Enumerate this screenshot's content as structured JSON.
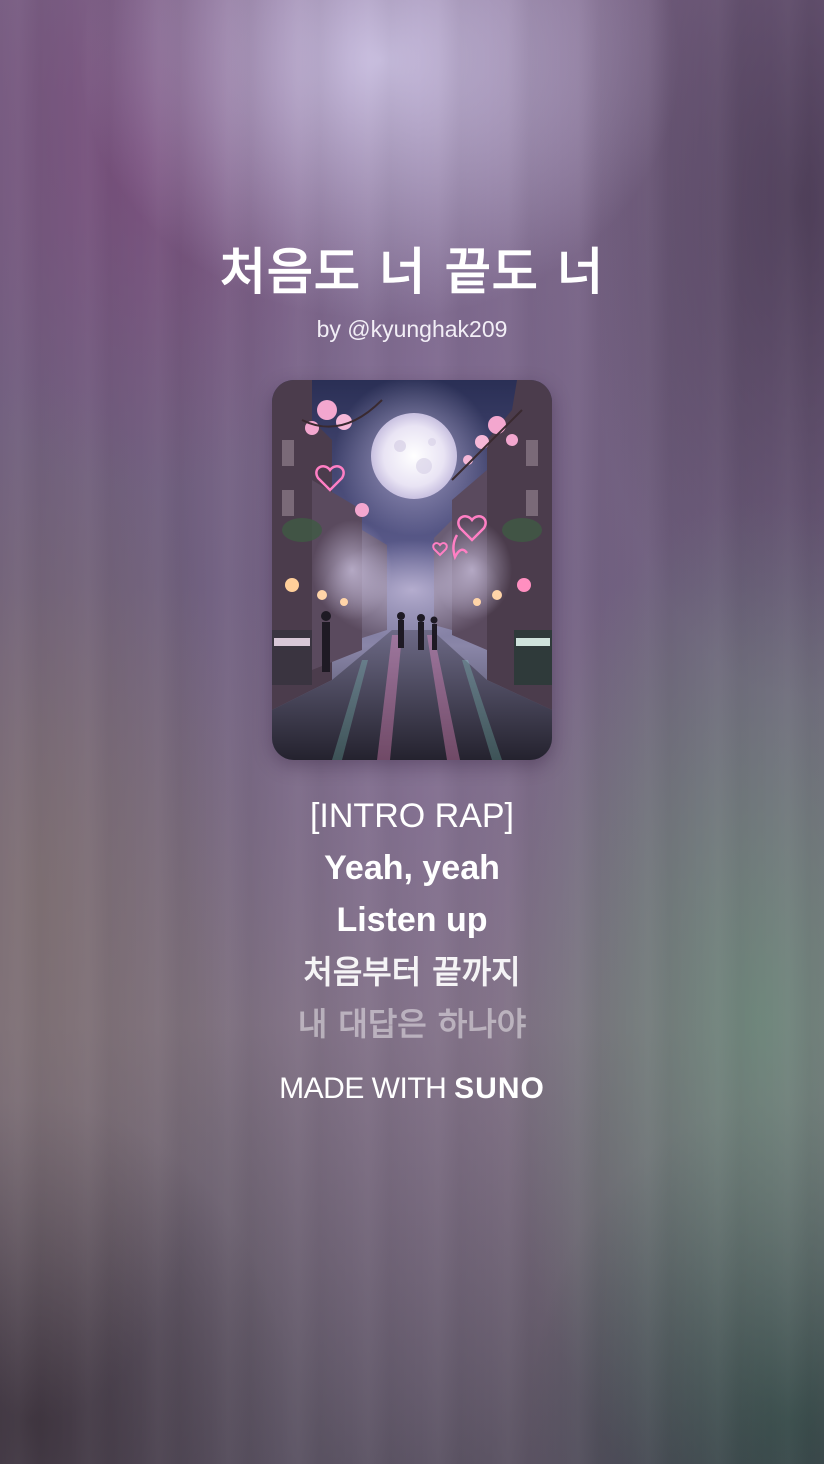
{
  "song": {
    "title": "처음도 너 끝도 너",
    "byline": "by @kyunghak209"
  },
  "lyrics": [
    "[INTRO RAP]",
    "Yeah, yeah",
    "Listen up",
    "처음부터 끝까지",
    "내 대답은 하나야"
  ],
  "footer": {
    "made_with": "MADE WITH",
    "brand": "SUNO"
  },
  "cover_art": {
    "description_icon": "album-cover-moonlit-night-market"
  }
}
